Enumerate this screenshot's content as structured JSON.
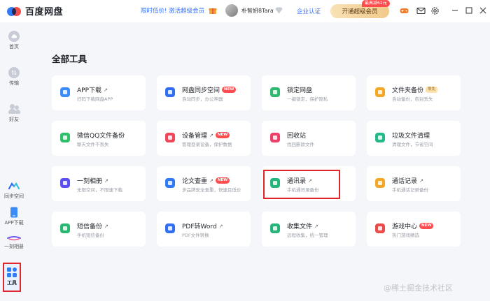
{
  "app": {
    "title": "百度网盘"
  },
  "titlebar": {
    "promo": "限时低价! 激活超级会员",
    "username": "朴智妍8Tara",
    "enterprise": "企业认证",
    "vip_button": "开通超级会员",
    "vip_tag": "最高减62元"
  },
  "sidebar": {
    "items": [
      {
        "label": "首页",
        "icon": "cloud-icon"
      },
      {
        "label": "传输",
        "icon": "transfer-icon"
      },
      {
        "label": "好友",
        "icon": "friends-icon"
      },
      {
        "label": "同步空间",
        "icon": "sync-icon"
      },
      {
        "label": "APP下载",
        "icon": "phone-icon"
      },
      {
        "label": "一刻相册",
        "icon": "album-icon"
      },
      {
        "label": "工具",
        "icon": "tools-grid-icon"
      }
    ]
  },
  "main": {
    "title": "全部工具",
    "tools": [
      {
        "name": "APP下载",
        "desc": "扫码下载网盘APP",
        "arrow": "↗",
        "badge": "",
        "icon": "phone-icon",
        "color": "#3b8cf7"
      },
      {
        "name": "网盘同步空间",
        "desc": "自动同步，办公神器",
        "arrow": "",
        "badge": "NEW",
        "icon": "sync-space-icon",
        "color": "#2f6ff0"
      },
      {
        "name": "锁定网盘",
        "desc": "一键锁定，保护隐私",
        "arrow": "",
        "badge": "",
        "icon": "lock-icon",
        "color": "#2fb86f"
      },
      {
        "name": "文件夹备份",
        "desc": "自动备份，告别丢失",
        "arrow": "",
        "badge": "限免",
        "icon": "folder-backup-icon",
        "color": "#f5a623"
      },
      {
        "name": "微信QQ文件备份",
        "desc": "聊天文件不丢失",
        "arrow": "",
        "badge": "",
        "icon": "wechat-icon",
        "color": "#2fbf6a"
      },
      {
        "name": "设备管理",
        "desc": "管理登录设备，保护数据",
        "arrow": "↗",
        "badge": "NEW",
        "icon": "device-icon",
        "color": "#f0455a"
      },
      {
        "name": "回收站",
        "desc": "找回删除文件",
        "arrow": "",
        "badge": "",
        "icon": "recycle-icon",
        "color": "#ee3f6a"
      },
      {
        "name": "垃圾文件清理",
        "desc": "清理文件，节省空间",
        "arrow": "",
        "badge": "",
        "icon": "trash-clean-icon",
        "color": "#22b88a"
      },
      {
        "name": "一刻相册",
        "desc": "无限空间，不限速下载",
        "arrow": "↗",
        "badge": "",
        "icon": "album-icon",
        "color": "#5a4ff0"
      },
      {
        "name": "论文查重",
        "desc": "多品牌安全查重，快速且低价",
        "arrow": "↗",
        "badge": "NEW",
        "icon": "paper-check-icon",
        "color": "#2f7cf6"
      },
      {
        "name": "通讯录",
        "desc": "手机通讯录备份",
        "arrow": "↗",
        "badge": "",
        "icon": "contacts-icon",
        "color": "#25b479"
      },
      {
        "name": "通话记录",
        "desc": "手机通话记录备份",
        "arrow": "↗",
        "badge": "",
        "icon": "phone-call-icon",
        "color": "#f5a623"
      },
      {
        "name": "短信备份",
        "desc": "手机短信备份",
        "arrow": "↗",
        "badge": "",
        "icon": "sms-icon",
        "color": "#28b871"
      },
      {
        "name": "PDF转Word",
        "desc": "PDF文件转换",
        "arrow": "↗",
        "badge": "",
        "icon": "word-icon",
        "color": "#2f6ff0"
      },
      {
        "name": "收集文件",
        "desc": "远程收集，统一管理",
        "arrow": "↗",
        "badge": "",
        "icon": "collect-icon",
        "color": "#25b479"
      },
      {
        "name": "游戏中心",
        "desc": "热门游戏精选",
        "arrow": "",
        "badge": "NEW",
        "icon": "game-icon",
        "color": "#e94b4b"
      }
    ]
  },
  "watermark": "@稀土掘金技术社区"
}
